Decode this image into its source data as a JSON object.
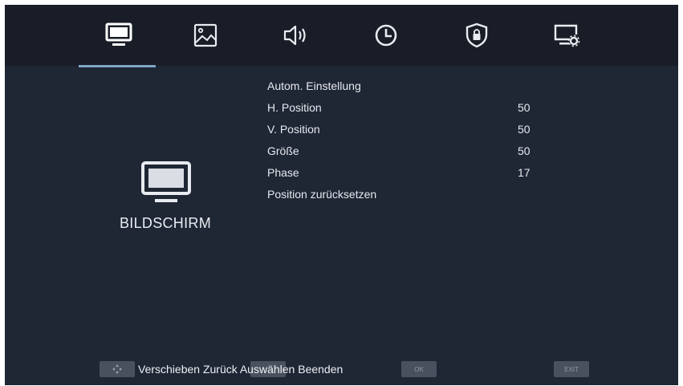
{
  "tabs": [
    {
      "icon": "monitor-icon",
      "active": true
    },
    {
      "icon": "picture-icon",
      "active": false
    },
    {
      "icon": "speaker-icon",
      "active": false
    },
    {
      "icon": "clock-icon",
      "active": false
    },
    {
      "icon": "shield-lock-icon",
      "active": false
    },
    {
      "icon": "display-settings-icon",
      "active": false
    }
  ],
  "section": {
    "title": "BILDSCHIRM",
    "icon": "monitor-icon"
  },
  "menu": [
    {
      "label": "Autom. Einstellung",
      "value": ""
    },
    {
      "label": "H. Position",
      "value": "50"
    },
    {
      "label": "V. Position",
      "value": "50"
    },
    {
      "label": "Größe",
      "value": "50"
    },
    {
      "label": "Phase",
      "value": "17"
    },
    {
      "label": "Position zurücksetzen",
      "value": ""
    }
  ],
  "footer": {
    "text": "Verschieben Zurück Auswählen Beenden",
    "keys": {
      "move": "",
      "back": "",
      "ok": "OK",
      "exit": "EXIT"
    }
  },
  "colors": {
    "screen_bg": "#1f2634",
    "tabbar_bg": "#191d27",
    "accent": "#7fa6c6",
    "text": "#e7eaf0"
  }
}
